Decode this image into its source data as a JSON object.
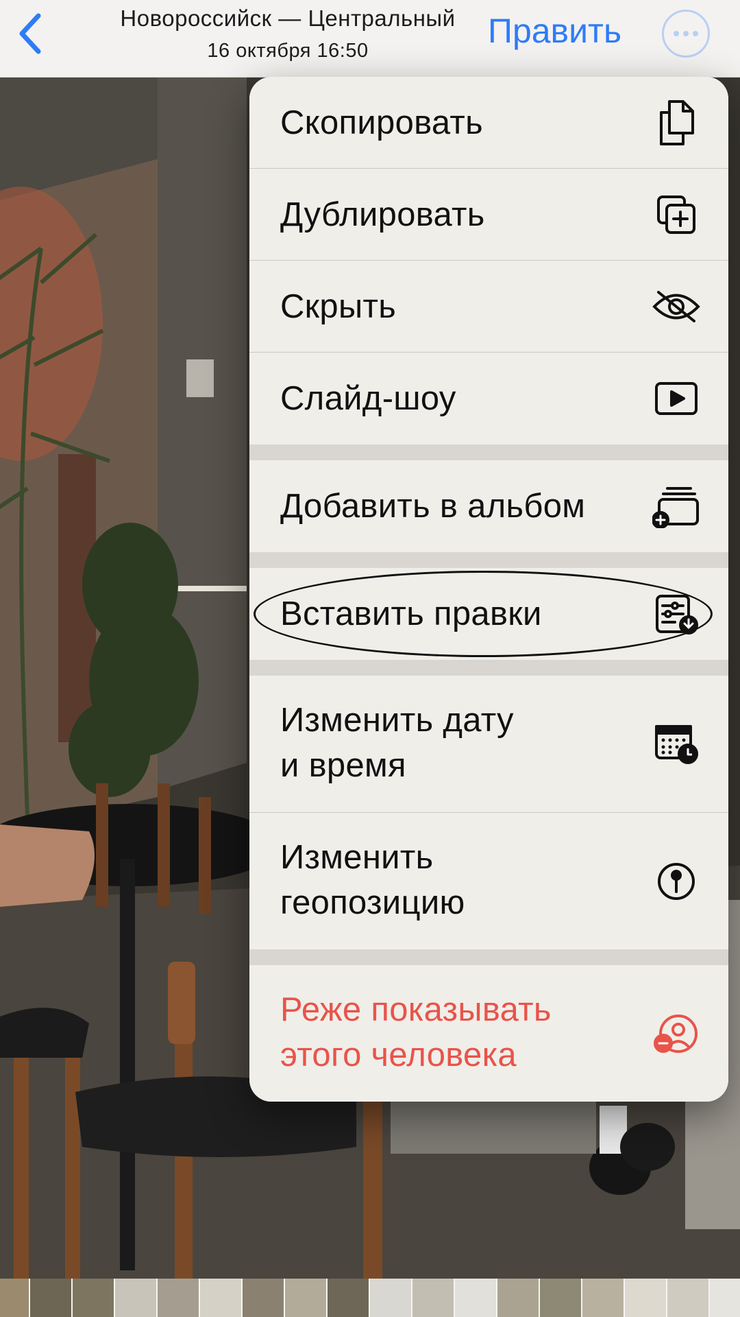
{
  "nav": {
    "title": "Новороссийск — Центральный",
    "subtitle": "16 октября  16:50",
    "edit_label": "Править",
    "back_icon": "chevron-left-icon",
    "more_icon": "ellipsis-circle-icon",
    "accent_color": "#2e7cf6"
  },
  "menu": {
    "items": [
      {
        "label": "Скопировать",
        "icon": "copy-icon"
      },
      {
        "label": "Дублировать",
        "icon": "duplicate-icon"
      },
      {
        "label": "Скрыть",
        "icon": "eye-slash-icon"
      },
      {
        "label": "Слайд-шоу",
        "icon": "play-rectangle-icon"
      },
      {
        "label": "Добавить в альбом",
        "icon": "add-to-album-icon"
      },
      {
        "label": "Вставить правки",
        "icon": "paste-edits-icon"
      },
      {
        "label_line1": "Изменить дату",
        "label_line2": "и время",
        "icon": "calendar-clock-icon"
      },
      {
        "label_line1": "Изменить",
        "label_line2": "геопозицию",
        "icon": "location-pin-icon"
      },
      {
        "label_line1": "Реже показывать",
        "label_line2": "этого человека",
        "icon": "person-minus-icon",
        "color": "#e8544a"
      }
    ]
  },
  "annotation": {
    "type": "hand-drawn ellipse",
    "target": "Вставить правки"
  }
}
